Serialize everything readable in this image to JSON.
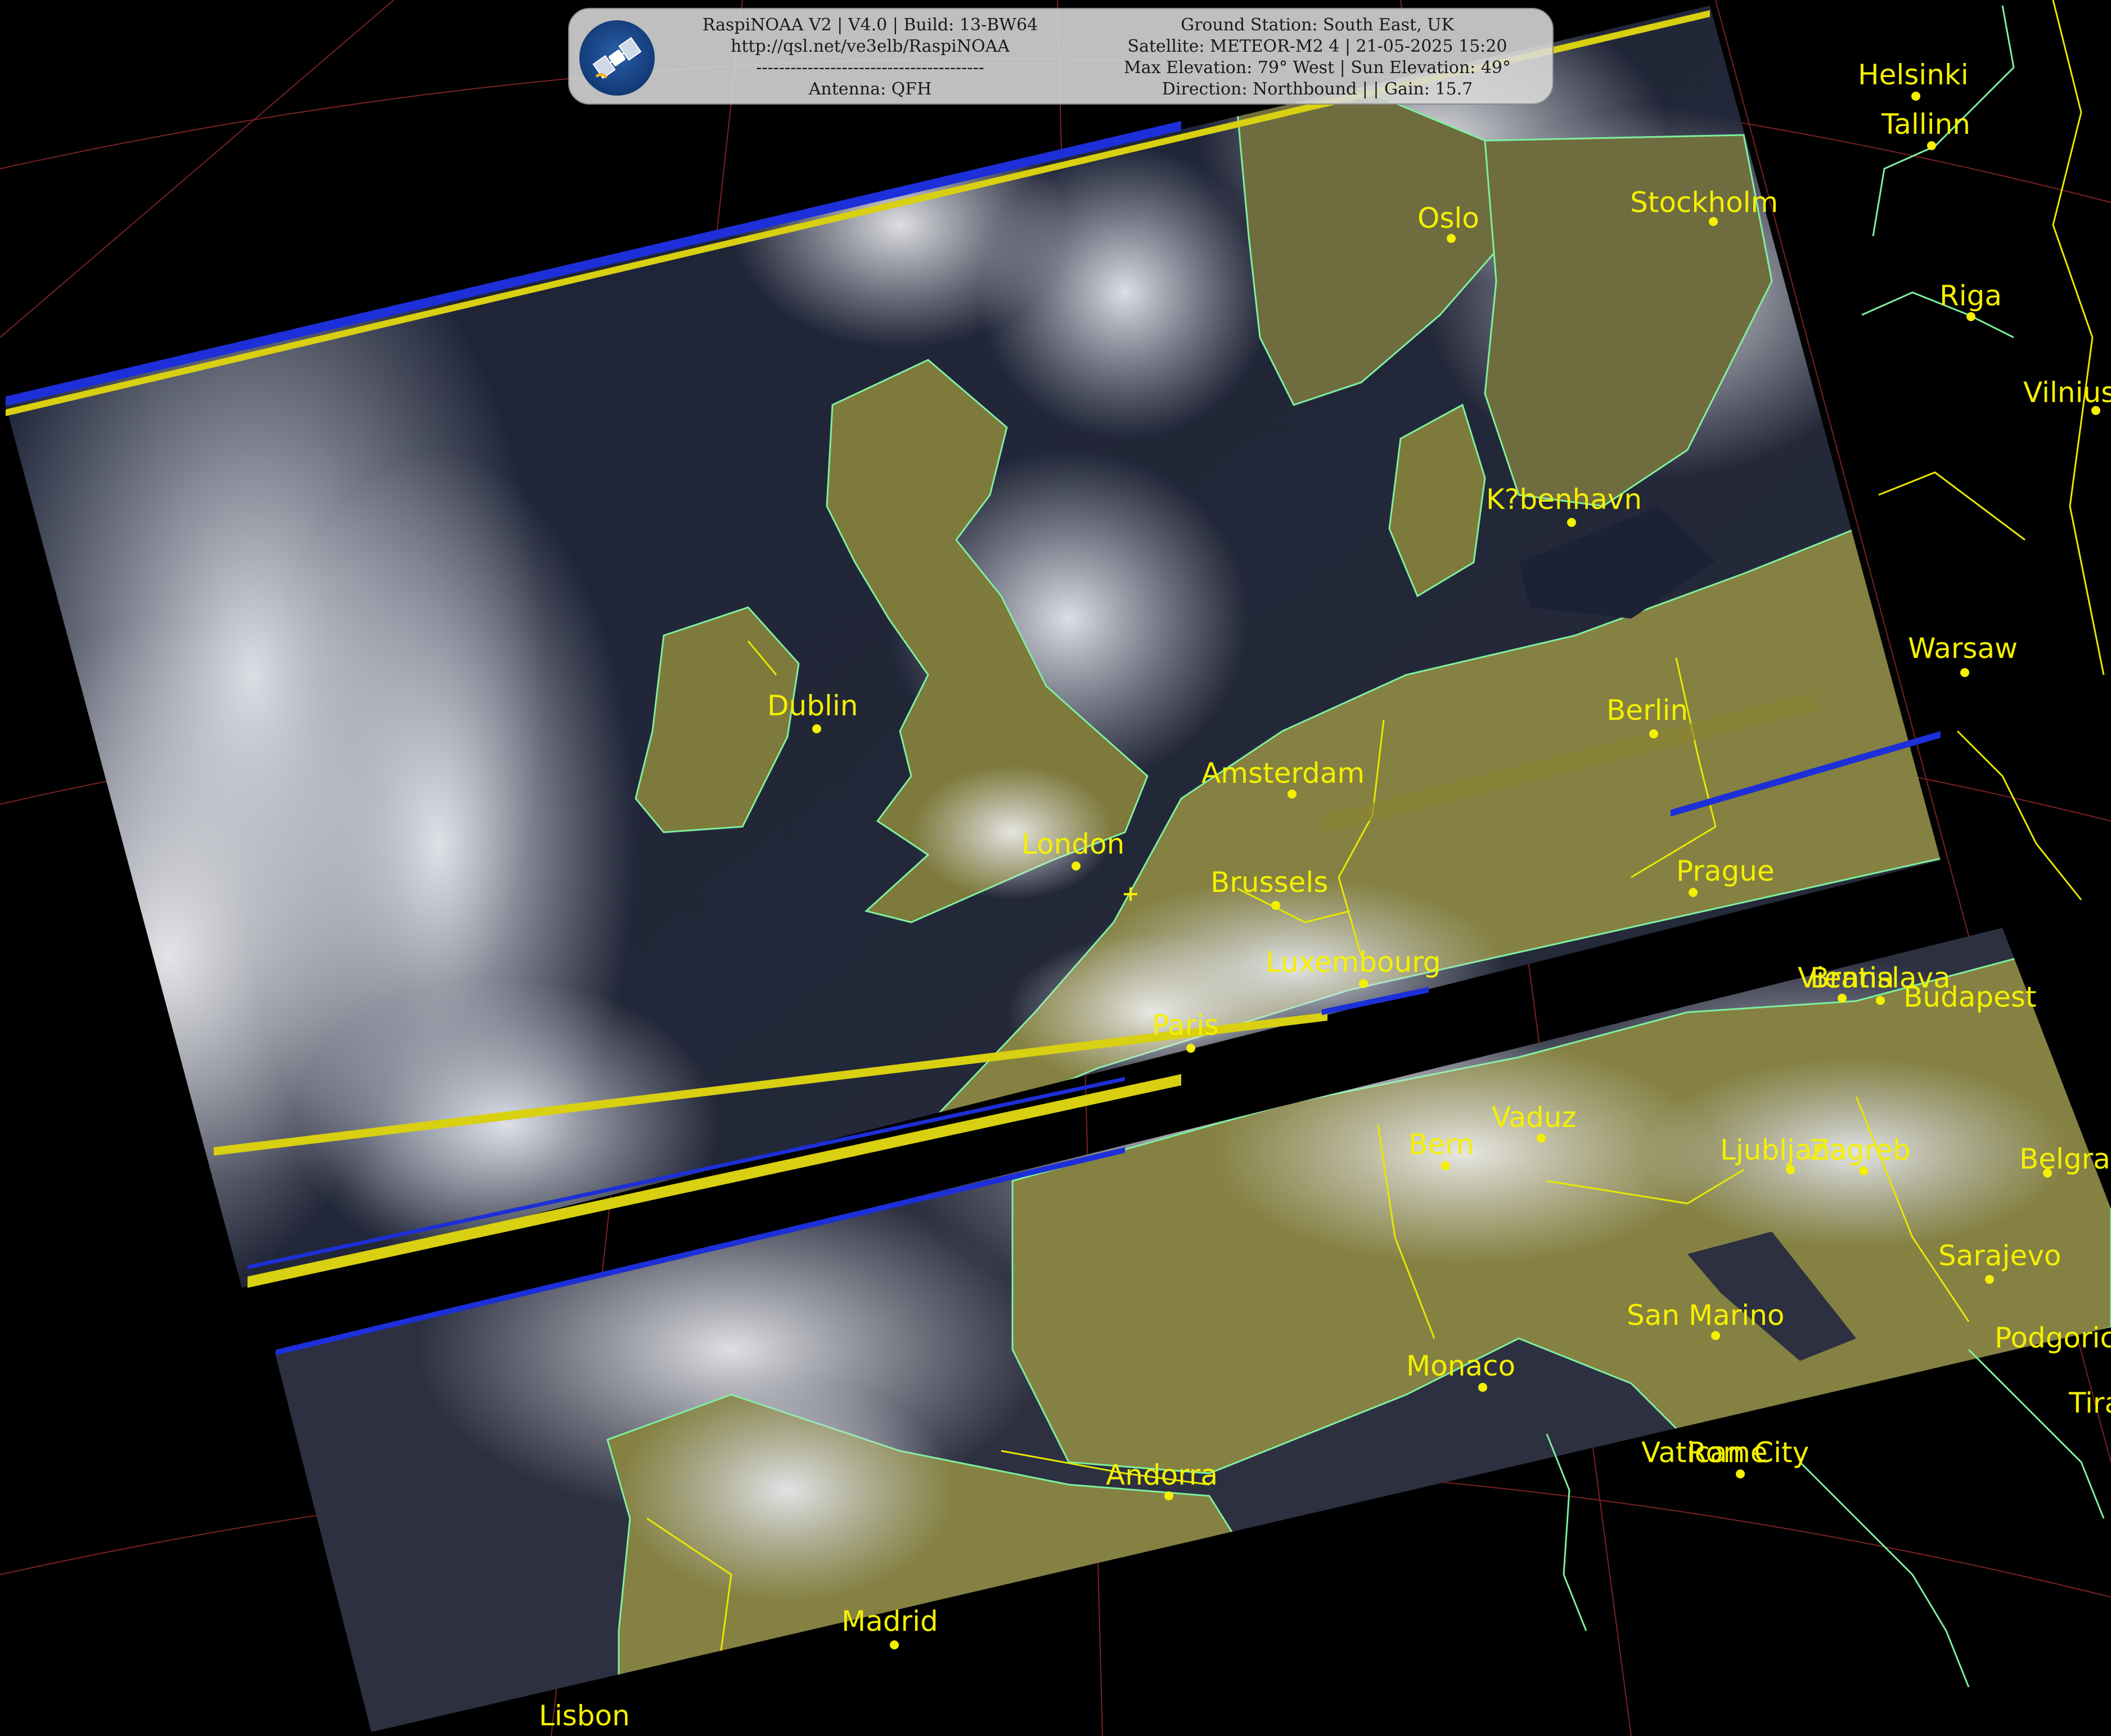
{
  "header": {
    "left_lines": [
      "RaspiNOAA V2 | V4.0 | Build: 13-BW64",
      "http://qsl.net/ve3elb/RaspiNOAA",
      "----------------------------------------",
      "Antenna: QFH"
    ],
    "right_lines": [
      "Ground Station: South East, UK",
      "Satellite: METEOR-M2 4 | 21-05-2025 15:20",
      "Max Elevation: 79° West | Sun Elevation: 49°",
      "Direction: Northbound | | Gain: 15.7"
    ],
    "logo_icon": "satellite-icon"
  },
  "cities": [
    {
      "name": "Helsinki"
    },
    {
      "name": "Tallinn"
    },
    {
      "name": "Stockholm"
    },
    {
      "name": "Oslo"
    },
    {
      "name": "Riga"
    },
    {
      "name": "Vilnius"
    },
    {
      "name": "K?benhavn"
    },
    {
      "name": "Warsaw"
    },
    {
      "name": "Berlin"
    },
    {
      "name": "Dublin"
    },
    {
      "name": "Amsterdam"
    },
    {
      "name": "London"
    },
    {
      "name": "Brussels"
    },
    {
      "name": "Prague"
    },
    {
      "name": "Luxembourg"
    },
    {
      "name": "Vienna"
    },
    {
      "name": "Bratislava"
    },
    {
      "name": "Budapest"
    },
    {
      "name": "Paris"
    },
    {
      "name": "Vaduz"
    },
    {
      "name": "Bern"
    },
    {
      "name": "Ljubljana"
    },
    {
      "name": "Zagreb"
    },
    {
      "name": "Belgrade"
    },
    {
      "name": "Sarajevo"
    },
    {
      "name": "San Marino"
    },
    {
      "name": "Monaco"
    },
    {
      "name": "Podgorica"
    },
    {
      "name": "Tirana"
    },
    {
      "name": "Vatican City"
    },
    {
      "name": "Rome"
    },
    {
      "name": "Andorra"
    },
    {
      "name": "Madrid"
    },
    {
      "name": "Lisbon"
    }
  ],
  "colors": {
    "background": "#000000",
    "city": "#f4f000",
    "coast": "#7ef0a0",
    "border": "#e8e800",
    "grid": "#b03030"
  }
}
